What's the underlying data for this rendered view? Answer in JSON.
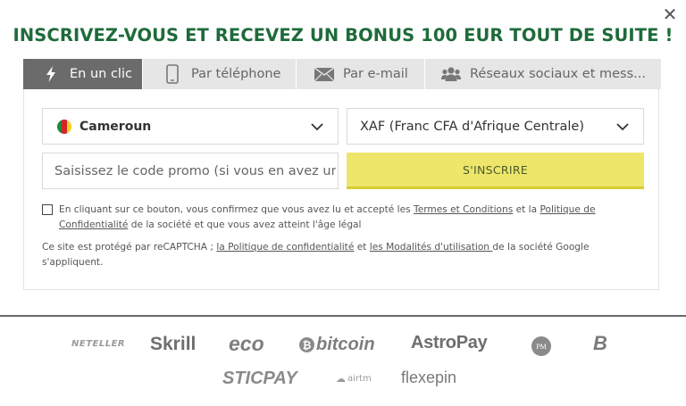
{
  "modal": {
    "title": "INSCRIVEZ-VOUS ET RECEVEZ UN BONUS 100 EUR TOUT DE SUITE !",
    "close_icon": "close-icon"
  },
  "tabs": [
    {
      "label": "En un clic",
      "icon": "lightning-icon",
      "active": true
    },
    {
      "label": "Par téléphone",
      "icon": "phone-icon",
      "active": false
    },
    {
      "label": "Par e-mail",
      "icon": "envelope-icon",
      "active": false
    },
    {
      "label": "Réseaux sociaux et mess...",
      "icon": "users-icon",
      "active": false
    }
  ],
  "form": {
    "country": "Cameroun",
    "currency": "XAF (Franc CFA d'Afrique Centrale)",
    "promo_placeholder": "Saisissez le code promo (si vous en avez un)",
    "signup_label": "S'INSCRIRE"
  },
  "terms": {
    "text_1": "En cliquant sur ce bouton, vous confirmez que vous avez lu et accepté les ",
    "link_terms": "Termes et Conditions",
    "text_2": " et la ",
    "link_privacy": "Politique de Confidentialité",
    "text_3": " de la société et que vous avez atteint l'âge légal"
  },
  "recaptcha": {
    "text_1": "Ce site est protégé par reCAPTCHA ; ",
    "link_privacy": "la Politique de confidentialité",
    "text_2": " et ",
    "link_terms": "les Modalités d'utilisation ",
    "text_3": "de la société Google s'appliquent."
  },
  "payment_methods": [
    "NETELLER",
    "Skrill",
    "eco",
    "bitcoin",
    "AstroPay",
    "PM",
    "B",
    "STICPAY",
    "airtm",
    "flexepin"
  ],
  "colors": {
    "title": "#1e6b3a",
    "active_tab": "#6b6b6b",
    "signup_button": "#ede66a"
  }
}
